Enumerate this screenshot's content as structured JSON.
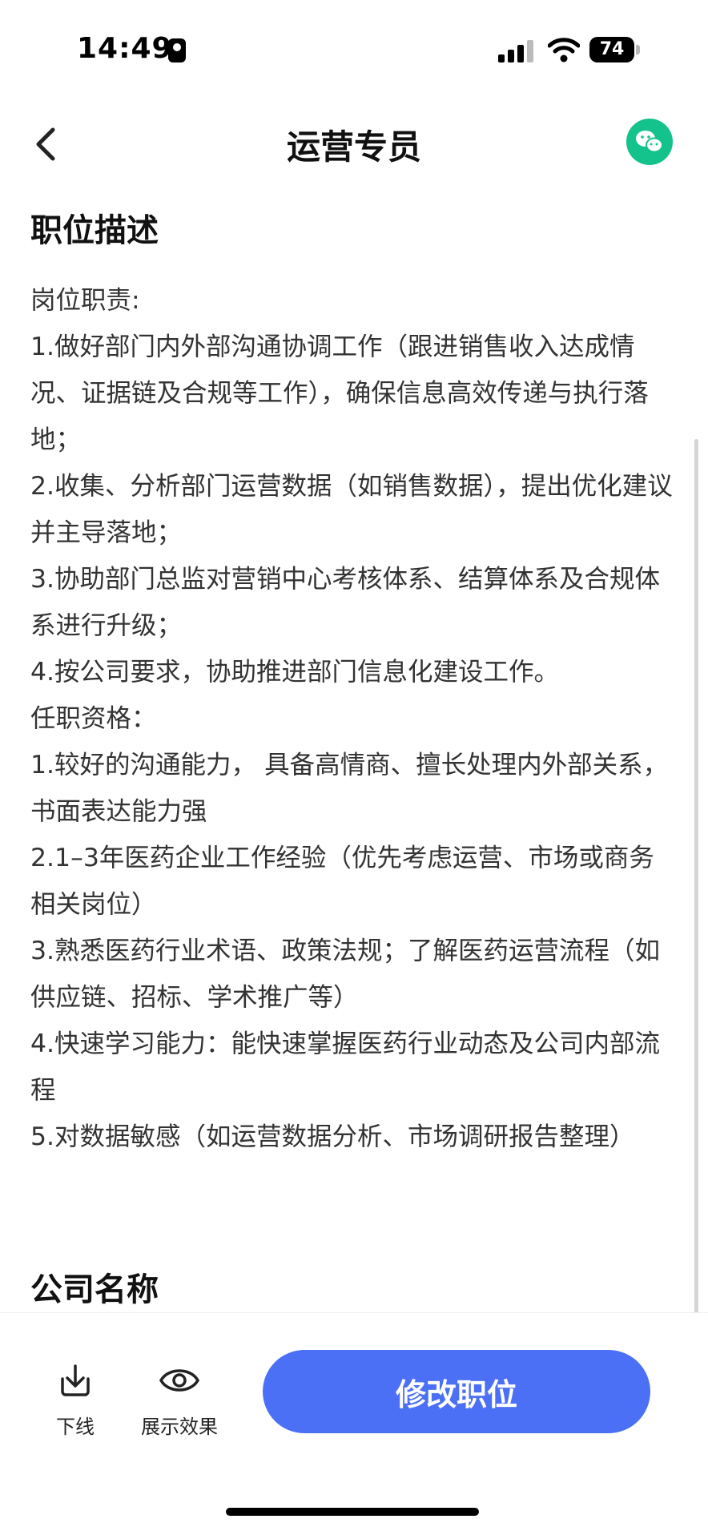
{
  "status": {
    "time": "14:49",
    "battery": "74"
  },
  "header": {
    "title": "运营专员"
  },
  "description": {
    "section_title": "职位描述",
    "lines": [
      "岗位职责:",
      "1.做好部门内外部沟通协调工作（跟进销售收入达成情况、证据链及合规等工作），确保信息高效传递与执行落地；",
      "2.收集、分析部门运营数据（如销售数据），提出优化建议并主导落地；",
      "3.协助部门总监对营销中心考核体系、结算体系及合规体系进行升级；",
      "4.按公司要求，协助推进部门信息化建设工作。",
      "任职资格：",
      "1.较好的沟通能力， 具备高情商、擅长处理内外部关系，书面表达能力强",
      "2.1–3年医药企业工作经验（优先考虑运营、市场或商务相关岗位）",
      "3.熟悉医药行业术语、政策法规；了解医药运营流程（如供应链、招标、学术推广等）",
      "4.快速学习能力：能快速掌握医药行业动态及公司内部流程",
      "5.对数据敏感（如运营数据分析、市场调研报告整理）"
    ]
  },
  "company": {
    "section_title": "公司名称"
  },
  "bottom": {
    "offline_label": "下线",
    "preview_label": "展示效果",
    "primary_label": "修改职位"
  },
  "colors": {
    "primary": "#4b70f5",
    "wechat": "#13c38b"
  }
}
